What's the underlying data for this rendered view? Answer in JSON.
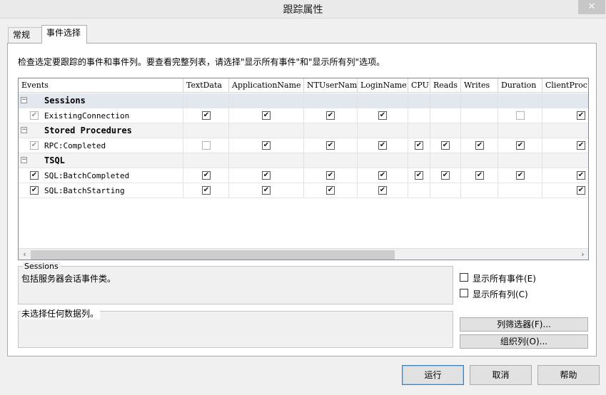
{
  "window": {
    "title": "跟踪属性",
    "close_glyph": "✕"
  },
  "tabs": [
    {
      "label": "常规",
      "active": false
    },
    {
      "label": "事件选择",
      "active": true
    }
  ],
  "description": "检查选定要跟踪的事件和事件列。要查看完整列表，请选择\"显示所有事件\"和\"显示所有列\"选项。",
  "grid": {
    "columns": [
      "Events",
      "TextData",
      "ApplicationName",
      "NTUserName",
      "LoginName",
      "CPU",
      "Reads",
      "Writes",
      "Duration",
      "ClientProc"
    ],
    "rows": [
      {
        "type": "category",
        "label": "Sessions",
        "expander": "−"
      },
      {
        "type": "event",
        "label": "ExistingConnection",
        "checked": true,
        "disabled": true,
        "cells": [
          "checked",
          "checked",
          "checked",
          "checked",
          "none",
          "none",
          "none",
          "empty",
          "checked"
        ]
      },
      {
        "type": "category",
        "label": "Stored Procedures",
        "expander": "−"
      },
      {
        "type": "event",
        "label": "RPC:Completed",
        "checked": true,
        "disabled": true,
        "cells": [
          "empty",
          "checked",
          "checked",
          "checked",
          "checked",
          "checked",
          "checked",
          "checked",
          "checked"
        ]
      },
      {
        "type": "category",
        "label": "TSQL",
        "expander": "−"
      },
      {
        "type": "event",
        "label": "SQL:BatchCompleted",
        "checked": true,
        "disabled": false,
        "cells": [
          "checked",
          "checked",
          "checked",
          "checked",
          "checked",
          "checked",
          "checked",
          "checked",
          "checked"
        ]
      },
      {
        "type": "event",
        "label": "SQL:BatchStarting",
        "checked": true,
        "disabled": false,
        "cells": [
          "checked",
          "checked",
          "checked",
          "checked",
          "none",
          "none",
          "none",
          "none",
          "checked"
        ]
      }
    ],
    "scroll_left": "‹",
    "scroll_right": "›"
  },
  "sessions_group": {
    "label": "Sessions",
    "text": "包括服务器会话事件类。"
  },
  "columns_group": {
    "text": "未选择任何数据列。"
  },
  "options": {
    "show_all_events": "显示所有事件(E)",
    "show_all_columns": "显示所有列(C)"
  },
  "buttons": {
    "column_filters": "列筛选器(F)...",
    "organize_columns": "组织列(O)...",
    "run": "运行",
    "cancel": "取消",
    "help": "帮助"
  },
  "check_glyph": "✔"
}
